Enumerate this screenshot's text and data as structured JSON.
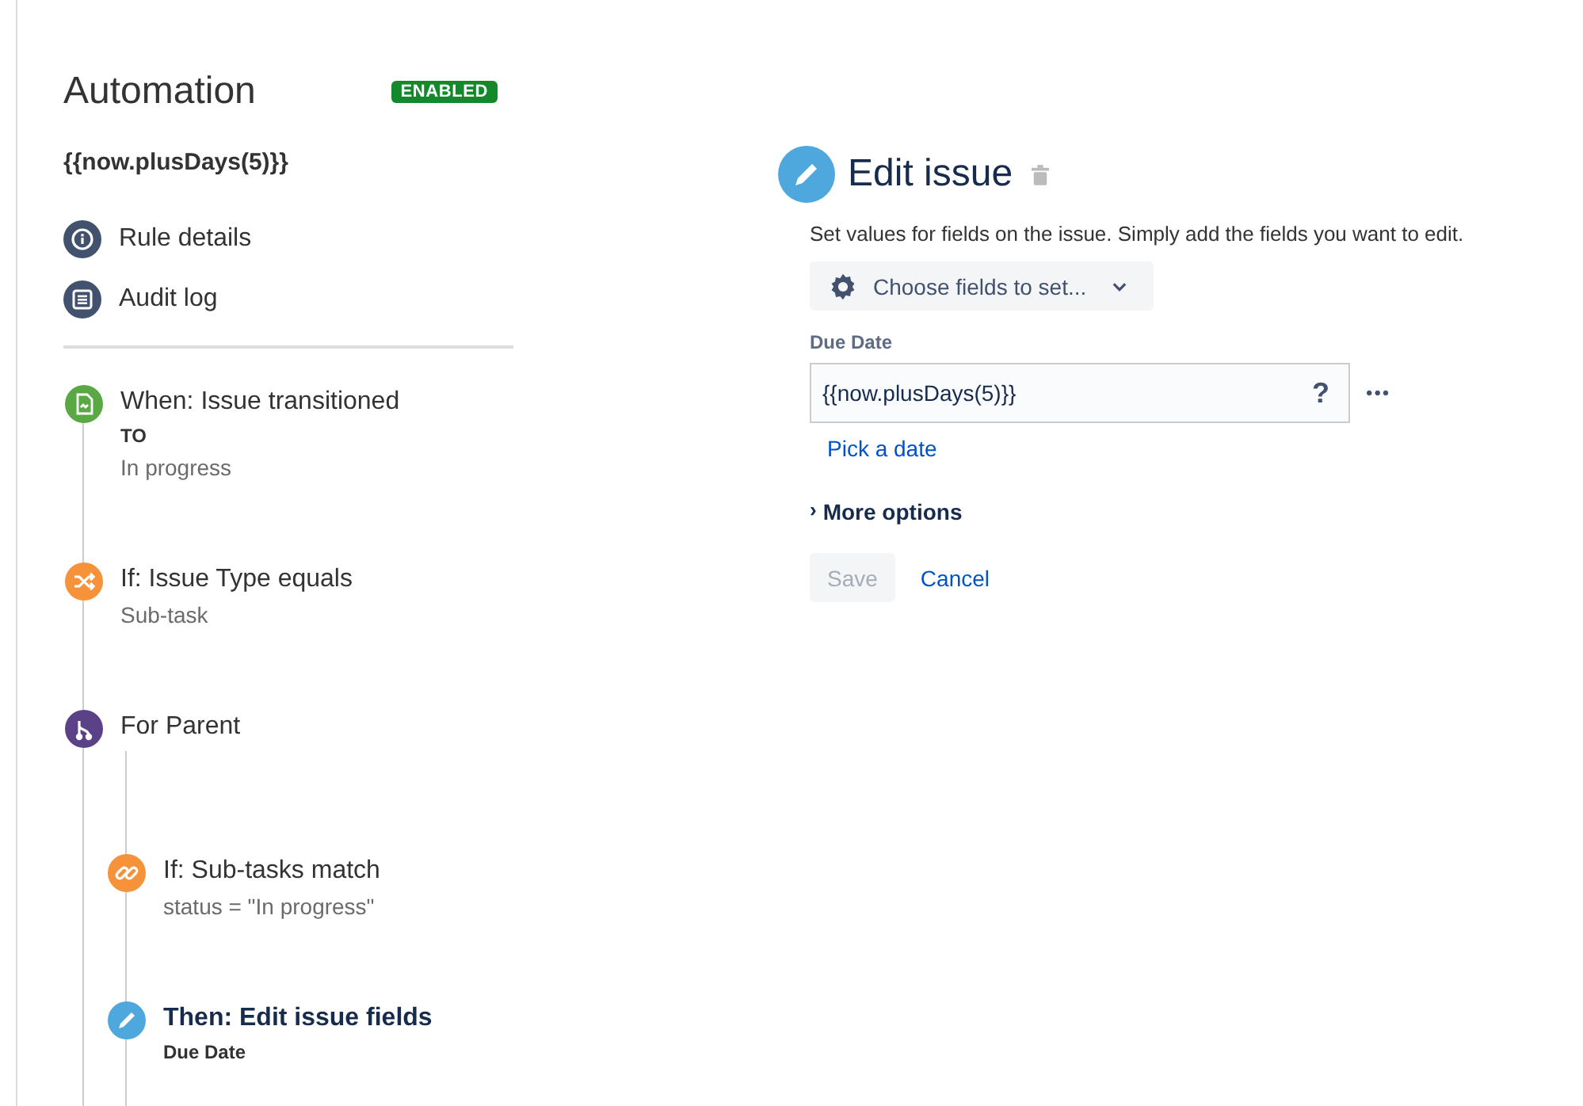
{
  "sidebar": {
    "title": "Automation",
    "status_badge": "ENABLED",
    "rule_name": "{{now.plusDays(5)}}",
    "links": [
      {
        "label": "Rule details",
        "kind": "info"
      },
      {
        "label": "Audit log",
        "kind": "log"
      }
    ],
    "steps": [
      {
        "kind": "trigger",
        "title": "When: Issue transitioned",
        "selected": false,
        "details": [
          {
            "text": "TO",
            "kind": "label"
          },
          {
            "text": "In progress",
            "kind": "value"
          }
        ]
      },
      {
        "kind": "condition",
        "title": "If: Issue Type equals",
        "selected": false,
        "details": [
          {
            "text": "Sub-task",
            "kind": "value"
          }
        ]
      },
      {
        "kind": "branch",
        "title": "For Parent",
        "selected": false,
        "children": [
          {
            "kind": "condition-link",
            "title": "If: Sub-tasks match",
            "selected": false,
            "details": [
              {
                "text": "status = \"In progress\"",
                "kind": "value"
              }
            ]
          },
          {
            "kind": "action",
            "title": "Then: Edit issue fields",
            "selected": true,
            "details": [
              {
                "text": "Due Date",
                "kind": "label"
              }
            ]
          }
        ]
      }
    ]
  },
  "editor": {
    "title": "Edit issue",
    "description": "Set values for fields on the issue. Simply add the fields you want to edit.",
    "choose_fields": "Choose fields to set...",
    "field": {
      "label": "Due Date",
      "value": "{{now.plusDays(5)}}",
      "help": "?",
      "more": "•••"
    },
    "pick_date": "Pick a date",
    "more_options": {
      "label": "More options",
      "chevron": "›",
      "expanded": false
    },
    "save": {
      "label": "Save",
      "disabled": true
    },
    "cancel": "Cancel"
  }
}
